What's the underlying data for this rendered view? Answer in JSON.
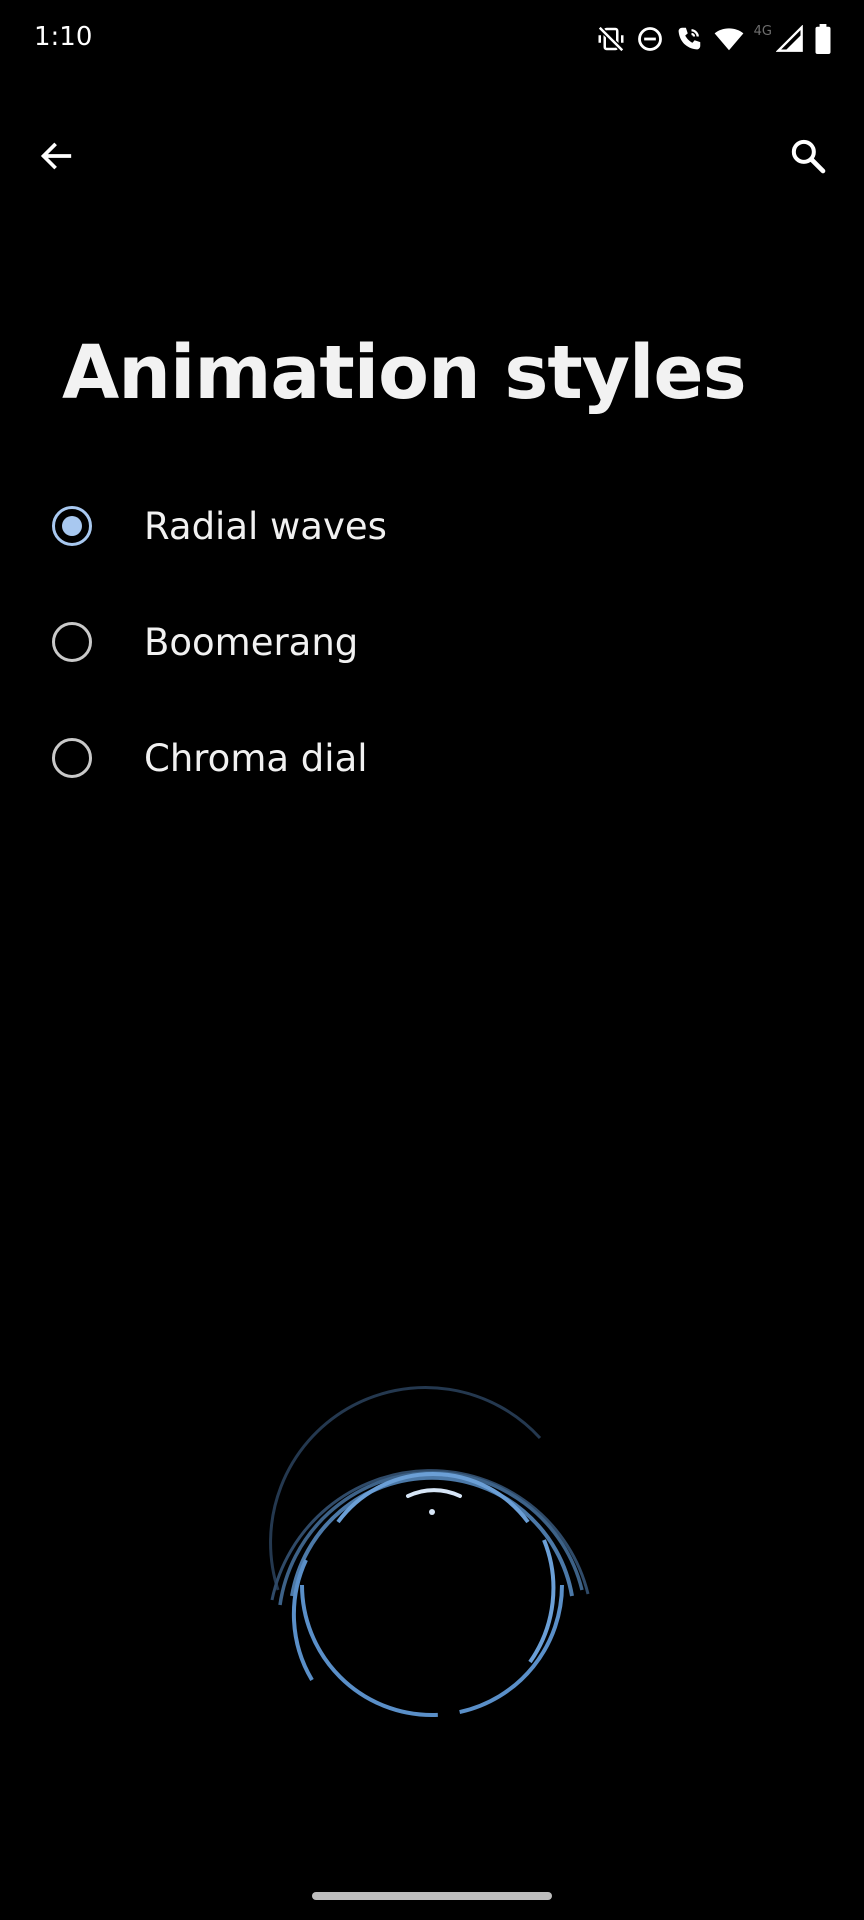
{
  "status_bar": {
    "time": "1:10",
    "network_label": "4G",
    "icons": [
      "vibrate-off-icon",
      "do-not-disturb-icon",
      "wifi-calling-icon",
      "wifi-icon",
      "cell-signal-icon",
      "battery-icon"
    ]
  },
  "toolbar": {
    "back_icon": "arrow-back-icon",
    "search_icon": "search-icon"
  },
  "page": {
    "title": "Animation styles"
  },
  "options": [
    {
      "label": "Radial waves",
      "selected": true
    },
    {
      "label": "Boomerang",
      "selected": false
    },
    {
      "label": "Chroma dial",
      "selected": false
    }
  ],
  "colors": {
    "background": "#000000",
    "accent": "#a8c8f0",
    "ring": "#5a8fc8",
    "text": "#f1f1f1"
  }
}
